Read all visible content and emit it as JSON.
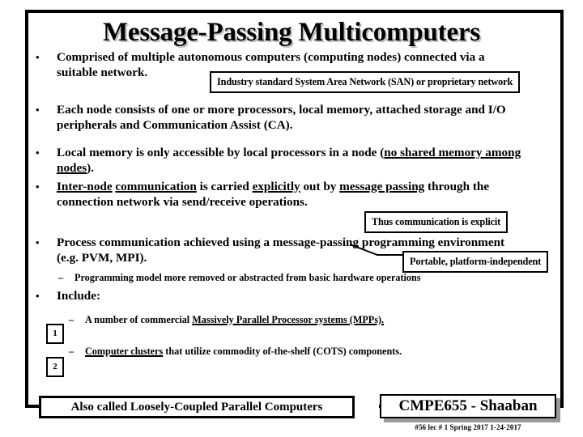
{
  "slide": {
    "title": "Message-Passing Multicomputers",
    "bullet_glyph": "•",
    "dash_glyph": "–",
    "bullets": [
      {
        "id": "comprised",
        "html": "Comprised of multiple autonomous computers (computing nodes) connected via a suitable network."
      },
      {
        "id": "each-node",
        "html": "Each node consists of one or more processors, local memory, attached storage and I/O peripherals and Communication Assist (CA)."
      },
      {
        "id": "local-memory",
        "html": "Local memory is only accessible by local processors in a node (<u>no shared memory among nodes</u>)."
      },
      {
        "id": "inter-node",
        "html": "<u>Inter-node</u> <u>communication</u> is carried <u>explicitly</u> out by <u>message passing</u> through the connection network via send/receive operations."
      },
      {
        "id": "process-communication",
        "html": "Process communication achieved using a message-passing programming environment (e.g. PVM, MPI)."
      },
      {
        "id": "include",
        "html": "Include:"
      }
    ],
    "sub_bullets": [
      {
        "id": "programming-model",
        "html": "Programming model more removed or abstracted from basic hardware operations"
      },
      {
        "id": "mpps",
        "html": "A number of commercial <u>Massively Parallel Processor systems (MPPs).</u>"
      },
      {
        "id": "clusters",
        "html": "<u>Computer clusters</u> that utilize commodity of-the-shelf (COTS) components."
      }
    ],
    "callouts": [
      {
        "id": "san",
        "text": "Industry standard System Area Network (SAN) or proprietary network"
      },
      {
        "id": "explicit",
        "text": "Thus communication is explicit"
      },
      {
        "id": "portable",
        "text": "Portable, platform-independent"
      }
    ],
    "markers": [
      {
        "id": "marker-1",
        "label": "1"
      },
      {
        "id": "marker-2",
        "label": "2"
      }
    ],
    "footer": {
      "note": "Also called Loosely-Coupled Parallel Computers",
      "course": "CMPE655 - Shaaban",
      "meta": "#56   lec # 1    Spring 2017    1-24-2017"
    },
    "colors": {
      "text": "#000000",
      "background": "#ffffff",
      "frame": "#000000",
      "title_shadow": "#bdbdbd",
      "box_shadow": "#9a9a9a"
    }
  }
}
